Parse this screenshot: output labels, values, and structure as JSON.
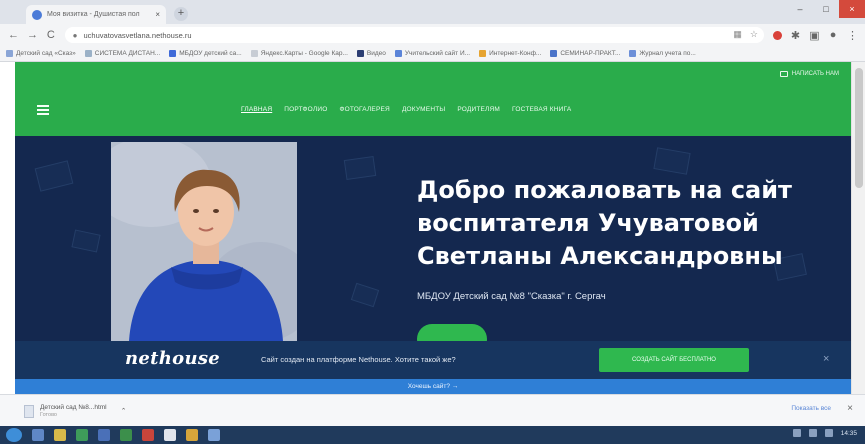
{
  "browser": {
    "tab_title": "Моя визитка - Душистая пол",
    "tab_close": "×",
    "new_tab": "+",
    "window_controls": {
      "minimize": "–",
      "maximize": "□",
      "close": "×"
    },
    "nav": {
      "back": "←",
      "forward": "→",
      "reload": "C"
    },
    "url": "uchuvatovasvetlana.nethouse.ru",
    "bookmarks": [
      {
        "label": "Детский сад «Сказ»",
        "color": "#8aa5d6"
      },
      {
        "label": "СИСТЕМА ДИСТАН...",
        "color": "#9bb1c7"
      },
      {
        "label": "МБДОУ детский са...",
        "color": "#3f6ad8"
      },
      {
        "label": "Яндекс.Карты - Google Кар...",
        "color": "#c7ccd4"
      },
      {
        "label": "Видео",
        "color": "#2c3e73"
      },
      {
        "label": "Учительский сайт И...",
        "color": "#5b84d8"
      },
      {
        "label": "Интернет-Конф...",
        "color": "#e6a431"
      },
      {
        "label": "СЕМИНАР-ПРАКТ...",
        "color": "#4b74c9"
      },
      {
        "label": "Журнал учета по...",
        "color": "#6c8fd8"
      }
    ]
  },
  "site": {
    "header_link": "Написать нам",
    "nav": [
      {
        "label": "Главная",
        "active": true
      },
      {
        "label": "Портфолио",
        "active": false
      },
      {
        "label": "Фотогалерея",
        "active": false
      },
      {
        "label": "Документы",
        "active": false
      },
      {
        "label": "Родителям",
        "active": false
      },
      {
        "label": "Гостевая книга",
        "active": false
      }
    ],
    "hero": {
      "title_line1": "Добро пожаловать на сайт",
      "title_line2": "воспитателя Учуватовой",
      "title_line3": "Светланы Александровны",
      "subtitle": "МБДОУ Детский сад №8 \"Сказка\" г. Сергач"
    },
    "promo": {
      "logo": "nethouse",
      "text": "Сайт создан на платформе Nethouse. Хотите такой же?",
      "button": "Создать сайт бесплатно",
      "close": "×"
    },
    "footer_link": "Хочешь сайт? →"
  },
  "downloads": {
    "file_name": "Детский сад №8...html",
    "status": "Готово",
    "caret": "⌃",
    "show_all": "Показать все",
    "close": "×"
  },
  "taskbar": {
    "clock": "14:35"
  },
  "colors": {
    "header_green": "#2aac4b",
    "hero_navy": "#14284f",
    "accent_green": "#2fb84f",
    "link_blue": "#2f7fd6"
  }
}
